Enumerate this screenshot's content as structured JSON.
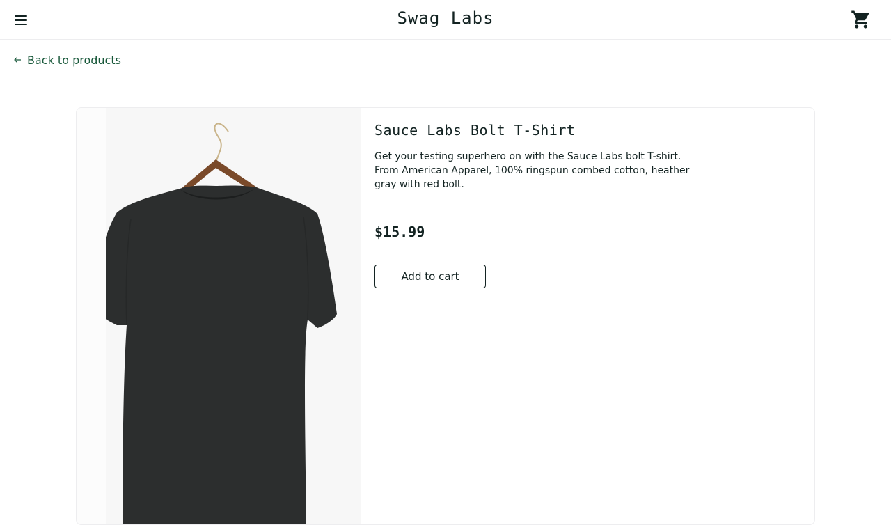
{
  "header": {
    "app_title": "Swag Labs",
    "menu_icon": "hamburger-menu-icon",
    "cart_icon": "shopping-cart-icon"
  },
  "subheader": {
    "back_label": "Back to products",
    "back_icon": "arrow-left-icon"
  },
  "product": {
    "name": "Sauce Labs Bolt T-Shirt",
    "description": "Get your testing superhero on with the Sauce Labs bolt T-shirt. From American Apparel, 100% ringspun combed cotton, heather gray with red bolt.",
    "price": "$15.99",
    "add_to_cart_label": "Add to cart"
  },
  "colors": {
    "text": "#132322",
    "back_link": "#18583a",
    "border": "#ededef",
    "shirt": "#2c2e2e"
  }
}
